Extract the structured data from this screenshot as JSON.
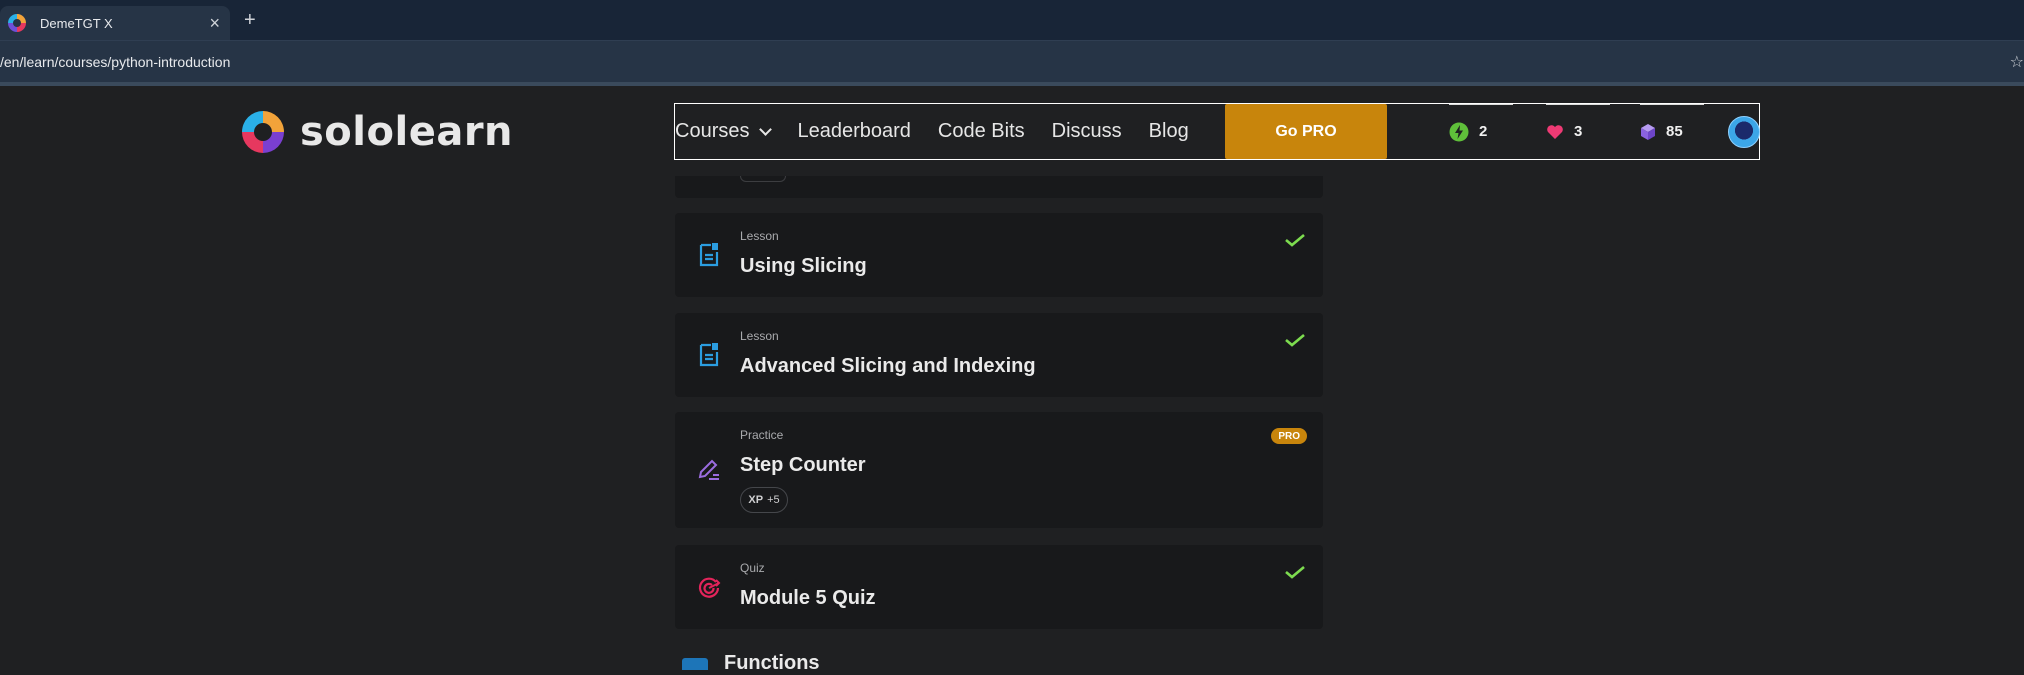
{
  "browser": {
    "tab_title": "DemeTGT X",
    "tab_close": "×",
    "new_tab": "+",
    "url": "/en/learn/courses/python-introduction"
  },
  "header": {
    "logo_text": "sololearn",
    "nav": {
      "courses": "Courses",
      "leaderboard": "Leaderboard",
      "code_bits": "Code Bits",
      "discuss": "Discuss",
      "blog": "Blog"
    },
    "go_pro": "Go PRO",
    "stats": {
      "streak": "2",
      "hearts": "3",
      "gems": "85"
    }
  },
  "lessons": [
    {
      "type": "Lesson",
      "title": "Using Slicing",
      "icon": "lesson-icon",
      "completed": true
    },
    {
      "type": "Lesson",
      "title": "Advanced Slicing and Indexing",
      "icon": "lesson-icon",
      "completed": true
    },
    {
      "type": "Practice",
      "title": "Step Counter",
      "icon": "practice-pencil-icon",
      "badge": "PRO",
      "xp_label": "XP",
      "xp_value": "+5"
    },
    {
      "type": "Quiz",
      "title": "Module 5 Quiz",
      "icon": "quiz-target-icon",
      "completed": true
    }
  ],
  "next_section": {
    "title": "Functions"
  },
  "colors": {
    "page_bg": "#1f2022",
    "card_bg": "#18191b",
    "accent_orange": "#c8850c",
    "check_green": "#7ddc4f",
    "lesson_blue": "#2b9de0",
    "practice_purple": "#9b6ce0",
    "quiz_red": "#e3245b"
  }
}
